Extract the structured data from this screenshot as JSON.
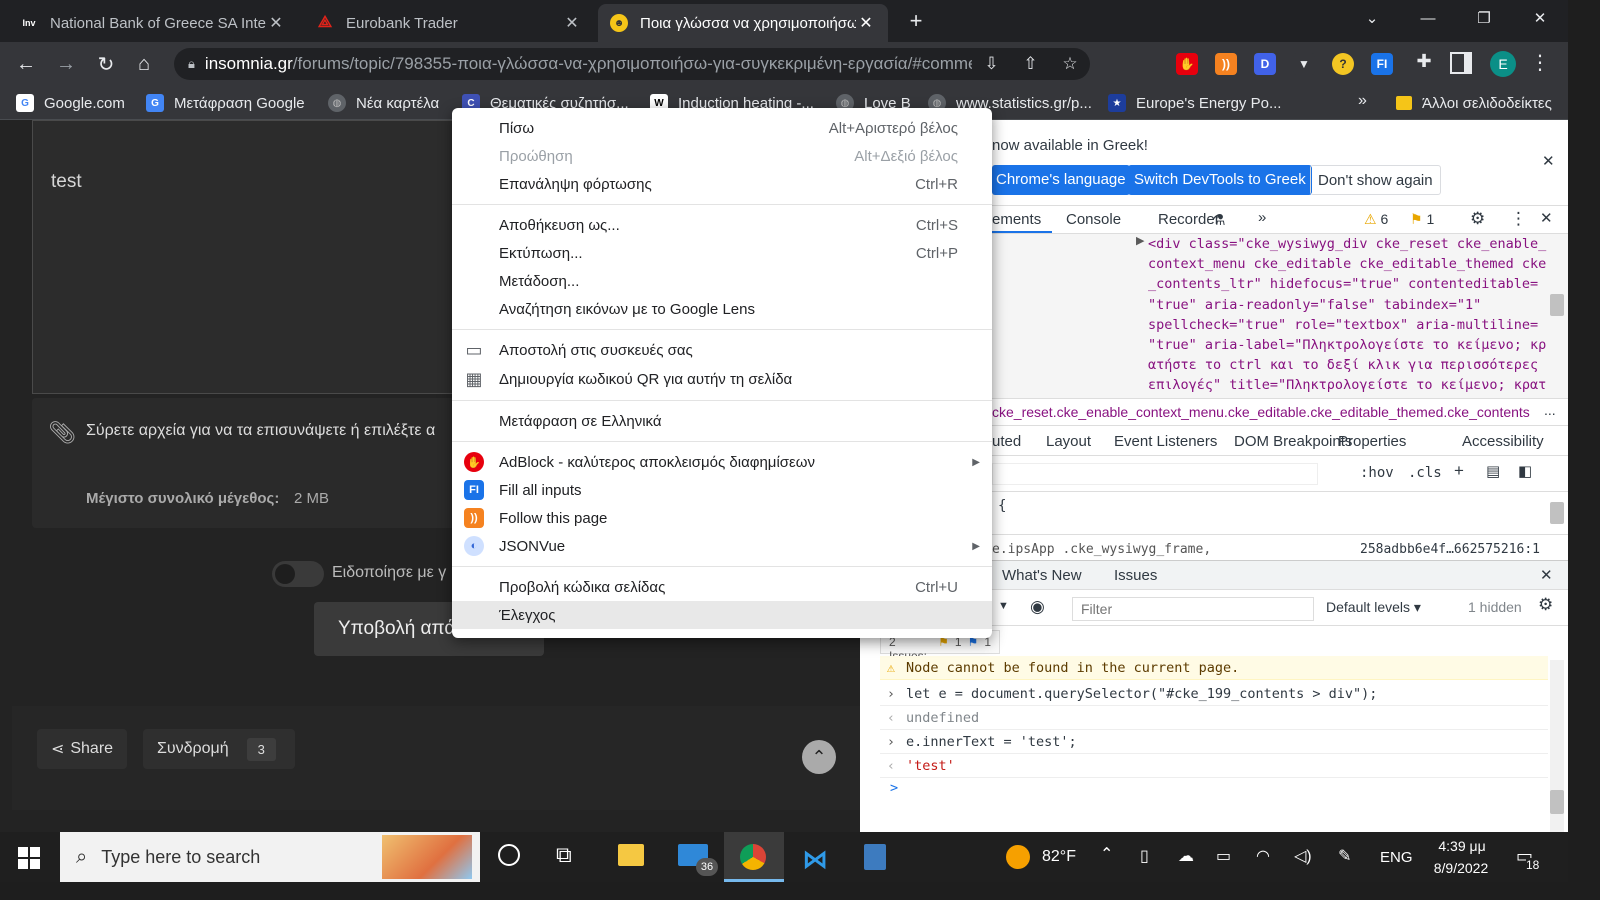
{
  "tabs": [
    {
      "title": "National Bank of Greece SA Inter",
      "icon": "investing-icon",
      "favicon_text": "Inv"
    },
    {
      "title": "Eurobank Trader",
      "icon": "eurobank-icon"
    },
    {
      "title": "Ποια γλώσσα να χρησιμοποιήσω",
      "icon": "insomnia-icon"
    }
  ],
  "omnibox": {
    "host": "insomnia.gr",
    "path": "/forums/topic/798355-ποια-γλώσσα-να-χρησιμοποιήσω-για-συγκεκριμένη-εργασία/#comme..."
  },
  "extensions": [
    {
      "name": "adblock-extension-icon",
      "color": "#e7000d",
      "text": "✋"
    },
    {
      "name": "rss-extension-icon",
      "color": "#f58220",
      "text": "))"
    },
    {
      "name": "d-extension-icon",
      "color": "#4162e8",
      "text": "D"
    },
    {
      "name": "vue-extension-icon",
      "color": "#35363a",
      "text": "▼"
    },
    {
      "name": "help-extension-icon",
      "color": "#f3c623",
      "text": "?"
    },
    {
      "name": "fill-inputs-extension-icon",
      "color": "#1a73e8",
      "text": "FI"
    }
  ],
  "profile_initial": "E",
  "bookmarks": [
    {
      "label": "Google.com",
      "icon": "google-icon",
      "color": "#fff",
      "text": "G"
    },
    {
      "label": "Μετάφραση Google",
      "icon": "translate-icon",
      "color": "#4285f4",
      "text": "G"
    },
    {
      "label": "Νέα καρτέλα",
      "icon": "globe-icon",
      "color": "#5f6368",
      "text": "◍"
    },
    {
      "label": "Θεματικές συζητήσ...",
      "icon": "c-icon",
      "color": "#3f51b5",
      "text": "C"
    },
    {
      "label": "Induction heating -...",
      "icon": "wikipedia-icon",
      "color": "#fff",
      "text": "W"
    },
    {
      "label": "Love B",
      "icon": "globe-icon",
      "color": "#5f6368",
      "text": "◍"
    },
    {
      "label": "www.statistics.gr/p...",
      "icon": "globe-icon",
      "color": "#5f6368",
      "text": "◍"
    },
    {
      "label": "Europe's Energy Po...",
      "icon": "eu-icon",
      "color": "#1d3d9c",
      "text": "★"
    }
  ],
  "bookmarks_overflow": "»",
  "other_bookmarks": "Άλλοι σελιδοδείκτες",
  "page": {
    "editor_text": "test",
    "attach_text": "Σύρετε αρχεία για να τα επισυνάψετε ή επιλέξτε α",
    "max_size_label": "Μέγιστο συνολικό μέγεθος:",
    "max_size_value": "2 MB",
    "notify_label": "Ειδοποίησε με γ",
    "submit_label": "Υποβολή απά",
    "share_label": "Share",
    "follow_label": "Συνδρομή",
    "follow_count": "3"
  },
  "context_menu": {
    "groups": [
      [
        {
          "label": "Πίσω",
          "shortcut": "Alt+Αριστερό βέλος",
          "disabled": false
        },
        {
          "label": "Προώθηση",
          "shortcut": "Alt+Δεξιό βέλος",
          "disabled": true
        },
        {
          "label": "Επανάληψη φόρτωσης",
          "shortcut": "Ctrl+R",
          "disabled": false
        }
      ],
      [
        {
          "label": "Αποθήκευση ως...",
          "shortcut": "Ctrl+S",
          "disabled": false
        },
        {
          "label": "Εκτύπωση...",
          "shortcut": "Ctrl+P",
          "disabled": false
        },
        {
          "label": "Μετάδοση...",
          "shortcut": "",
          "disabled": false
        },
        {
          "label": "Αναζήτηση εικόνων με το Google Lens",
          "shortcut": "",
          "disabled": false
        }
      ],
      [
        {
          "label": "Αποστολή στις συσκευές σας",
          "shortcut": "",
          "icon": "send-to-devices-icon"
        },
        {
          "label": "Δημιουργία κωδικού QR για αυτήν τη σελίδα",
          "shortcut": "",
          "icon": "qr-code-icon"
        }
      ],
      [
        {
          "label": "Μετάφραση σε Ελληνικά",
          "shortcut": ""
        }
      ],
      [
        {
          "label": "AdBlock - καλύτερος αποκλεισμός διαφημίσεων",
          "icon": "adblock-icon",
          "submenu": true
        },
        {
          "label": "Fill all inputs",
          "icon": "fill-inputs-icon"
        },
        {
          "label": "Follow this page",
          "icon": "rss-icon"
        },
        {
          "label": "JSONVue",
          "icon": "jsonvue-icon",
          "submenu": true
        }
      ],
      [
        {
          "label": "Προβολή κώδικα σελίδας",
          "shortcut": "Ctrl+U"
        },
        {
          "label": "Έλεγχος",
          "shortcut": "",
          "highlighted": true
        }
      ]
    ]
  },
  "devtools": {
    "lang_banner": "now available in Greek!",
    "lang_btn1": "Chrome's language",
    "lang_btn2": "Switch DevTools to Greek",
    "lang_btn3": "Don't show again",
    "tabs": [
      "ements",
      "Console",
      "Recorder"
    ],
    "warn_count": "6",
    "issue_count": "1",
    "dom_lines": [
      "<div class=\"cke_wysiwyg_div cke_reset cke_enable_",
      "context_menu cke_editable cke_editable_themed cke",
      "_contents_ltr\" hidefocus=\"true\" contenteditable=",
      "\"true\" aria-readonly=\"false\" tabindex=\"1\"",
      "spellcheck=\"true\" role=\"textbox\" aria-multiline=",
      "\"true\" aria-label=\"Πληκτρολογείστε το κείμενο; κρ",
      "ατήστε το ctrl και το δεξί κλικ για περισσότερες",
      "επιλογές\" title=\"Πληκτρολογείστε το κείμενο; κρατ"
    ],
    "breadcrumb": "cke_reset.cke_enable_context_menu.cke_editable.cke_editable_themed.cke_contents",
    "breadcrumb_more": "...",
    "style_tabs": [
      "uted",
      "Layout",
      "Event Listeners",
      "DOM Breakpoints",
      "Properties",
      "Accessibility"
    ],
    "hov": ":hov",
    "cls": ".cls",
    "style_brace": "{",
    "style_selector": "e.ipsApp .cke_wysiwyg_frame,",
    "style_source": "258adbb6e4f…662575216:1",
    "drawer_tabs": [
      "What's New",
      "Issues"
    ],
    "filter_placeholder": "Filter",
    "levels": "Default levels ▾",
    "hidden": "1 hidden",
    "issues_bar": "2 Issues:",
    "issues_warn": "1",
    "issues_info": "1",
    "console": [
      {
        "kind": "warn",
        "text": "Node cannot be found in the current page."
      },
      {
        "kind": "in",
        "text": "let e = document.querySelector(\"#cke_199_contents > div\");"
      },
      {
        "kind": "out",
        "text": "undefined"
      },
      {
        "kind": "in",
        "text": "e.innerText = 'test';"
      },
      {
        "kind": "outstr",
        "text": "'test'"
      }
    ],
    "prompt": ">"
  },
  "taskbar": {
    "search_placeholder": "Type here to search",
    "mail_badge": "36",
    "weather": "82°F",
    "lang": "ENG",
    "time": "4:39 μμ",
    "date": "8/9/2022",
    "notif_count": "18"
  }
}
